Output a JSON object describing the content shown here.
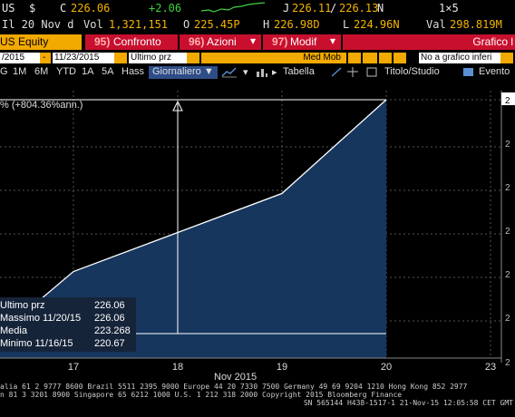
{
  "quote": {
    "ticker_suffix": "US",
    "currency": "$",
    "close_prefix": "C",
    "close": "226.06",
    "change": "+2.06",
    "bid_ask_prefix": "J",
    "bid": "226.11",
    "ask": "226.13",
    "size": "1×5",
    "date_line": "Il 20 Nov d",
    "volume_label": "Vol",
    "volume": "1,321,151",
    "open_label": "O",
    "open": "225.45P",
    "high_label": "H",
    "high": "226.98D",
    "low_label": "L",
    "low": "224.96N",
    "value_label": "Val",
    "value": "298.819M"
  },
  "sections": {
    "equity": "US Equity",
    "confronto_num": "95)",
    "confronto": "Confronto",
    "azioni_num": "96)",
    "azioni": "Azioni",
    "modif_num": "97)",
    "modif": "Modif",
    "grafico": "Grafico l"
  },
  "params": {
    "start_date": "/2015",
    "end_date": "11/23/2015",
    "field": "Ultimo prz",
    "med_mob": "Med Mob",
    "no_chart": "No a grafico inferi"
  },
  "toolbar": {
    "ranges": [
      "G",
      "1M",
      "6M",
      "YTD",
      "1A",
      "5A",
      "Hass"
    ],
    "period": "Giornaliero ▼",
    "tabella": "Tabella",
    "titolo": "Titolo/Studio",
    "evento": "Evento"
  },
  "annotation": "% (+804.36%ann.)",
  "legend": [
    {
      "label": "Ultimo prz",
      "value": "226.06"
    },
    {
      "label": "Massimo 11/20/15",
      "value": "226.06"
    },
    {
      "label": "Media",
      "value": "223.268"
    },
    {
      "label": "Minimo 11/16/15",
      "value": "220.67"
    }
  ],
  "chart_data": {
    "type": "area",
    "x": [
      "2015-11-16",
      "2015-11-17",
      "2015-11-18",
      "2015-11-19",
      "2015-11-20"
    ],
    "y": [
      220.67,
      222.1,
      223.0,
      223.9,
      226.06
    ],
    "xlabel": "Nov 2015",
    "xticks": [
      "17",
      "18",
      "19",
      "20",
      "23"
    ],
    "ylim": [
      220.0,
      226.5
    ],
    "right_ticks": [
      "2",
      "2",
      "2",
      "2",
      "2",
      "2",
      "2"
    ],
    "fill_color": "#16365e",
    "line_color": "#ffffff"
  },
  "footer": {
    "line1": "alia 61 2 9777 8600 Brazil 5511 2395 9000 Europe 44 20 7330 7500 Germany 49 69 9204 1210 Hong Kong 852 2977",
    "line2": "n 81 3 3201 8900        Singapore 65 6212 1000        U.S. 1 212 318 2000        Copyright 2015 Bloomberg Finance",
    "line3": "SN 565144 H438-1517-1 21-Nov-15 12:05:58 CET  GMT"
  }
}
